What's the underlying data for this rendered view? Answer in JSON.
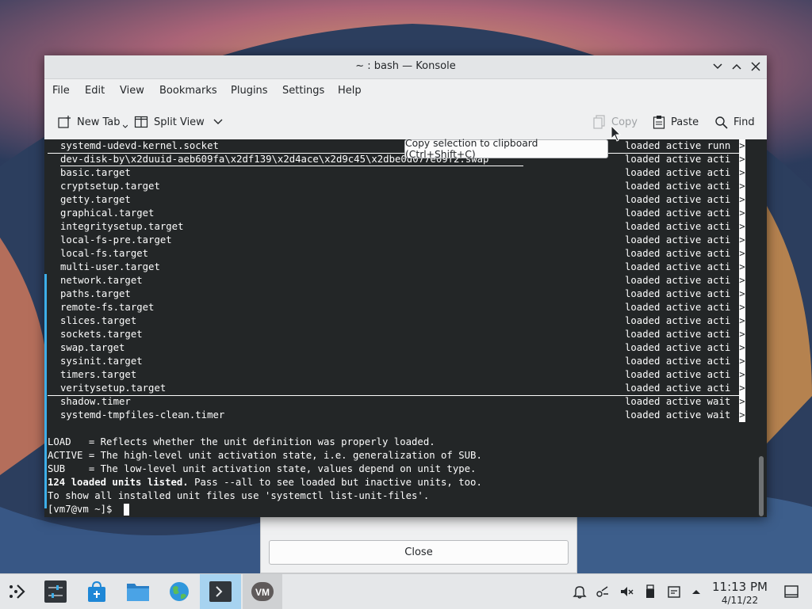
{
  "window": {
    "title": "~ : bash — Konsole"
  },
  "menubar": [
    "File",
    "Edit",
    "View",
    "Bookmarks",
    "Plugins",
    "Settings",
    "Help"
  ],
  "toolbar": {
    "new_tab": "New Tab",
    "split_view": "Split View",
    "copy": "Copy",
    "paste": "Paste",
    "find": "Find"
  },
  "tooltip": "Copy selection to clipboard (Ctrl+Shift+C)",
  "terminal": {
    "units": [
      {
        "name": "systemd-udevd-kernel.socket",
        "status": "loaded active runn"
      },
      {
        "name": "dev-disk-by\\x2duuid-aeb609fa\\x2df139\\x2d4ace\\x2d9c45\\x2dbe0d077e09f2.swap",
        "status": "loaded active acti"
      },
      {
        "name": "basic.target",
        "status": "loaded active acti"
      },
      {
        "name": "cryptsetup.target",
        "status": "loaded active acti"
      },
      {
        "name": "getty.target",
        "status": "loaded active acti"
      },
      {
        "name": "graphical.target",
        "status": "loaded active acti"
      },
      {
        "name": "integritysetup.target",
        "status": "loaded active acti"
      },
      {
        "name": "local-fs-pre.target",
        "status": "loaded active acti"
      },
      {
        "name": "local-fs.target",
        "status": "loaded active acti"
      },
      {
        "name": "multi-user.target",
        "status": "loaded active acti"
      },
      {
        "name": "network.target",
        "status": "loaded active acti"
      },
      {
        "name": "paths.target",
        "status": "loaded active acti"
      },
      {
        "name": "remote-fs.target",
        "status": "loaded active acti"
      },
      {
        "name": "slices.target",
        "status": "loaded active acti"
      },
      {
        "name": "sockets.target",
        "status": "loaded active acti"
      },
      {
        "name": "swap.target",
        "status": "loaded active acti"
      },
      {
        "name": "sysinit.target",
        "status": "loaded active acti"
      },
      {
        "name": "timers.target",
        "status": "loaded active acti"
      },
      {
        "name": "veritysetup.target",
        "status": "loaded active acti"
      },
      {
        "name": "shadow.timer",
        "status": "loaded active wait"
      },
      {
        "name": "systemd-tmpfiles-clean.timer",
        "status": "loaded active wait"
      }
    ],
    "truncation_marker": ">",
    "legend": [
      "LOAD   = Reflects whether the unit definition was properly loaded.",
      "ACTIVE = The high-level unit activation state, i.e. generalization of SUB.",
      "SUB    = The low-level unit activation state, values depend on unit type."
    ],
    "summary_bold": "124 loaded units listed.",
    "summary_rest": " Pass --all to see loaded but inactive units, too.",
    "hint": "To show all installed unit files use 'systemctl list-unit-files'.",
    "prompt": "[vm7@vm ~]$ "
  },
  "background_dialog": {
    "close_label": "Close"
  },
  "taskbar": {
    "clock_time": "11:13 PM",
    "clock_date": "4/11/22",
    "vm_label": "VM"
  },
  "colors": {
    "terminal_bg": "#232627",
    "terminal_fg": "#fcfcfc",
    "accent": "#3daee9",
    "window_bg": "#eff0f1",
    "taskbar_active": "#a7d3f0"
  }
}
